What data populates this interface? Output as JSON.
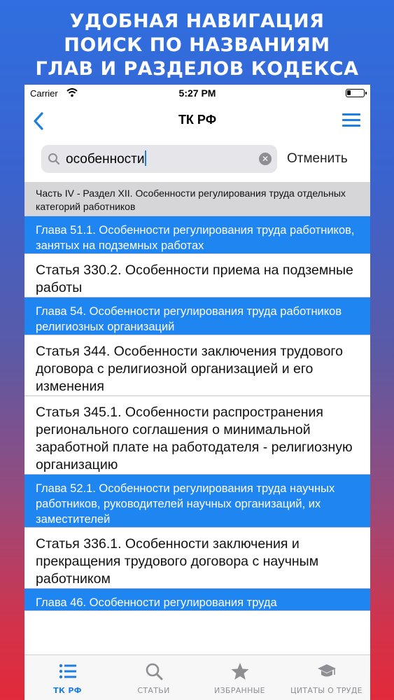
{
  "promo": {
    "line1": "УДОБНАЯ НАВИГАЦИЯ",
    "line2": "ПОИСК ПО НАЗВАНИЯМ",
    "line3": "ГЛАВ И РАЗДЕЛОВ КОДЕКСА"
  },
  "status": {
    "carrier": "Carrier",
    "time": "5:27 PM"
  },
  "nav": {
    "title": "ТК РФ"
  },
  "search": {
    "value": "особенности",
    "cancel_label": "Отменить"
  },
  "results": [
    {
      "type": "part",
      "text": "Часть IV - Раздел XII. Особенности регулирования труда отдельных категорий работников"
    },
    {
      "type": "chapter",
      "text": "Глава 51.1. Особенности регулирования труда работников, занятых на подземных работах"
    },
    {
      "type": "article",
      "text": "Статья 330.2. Особенности приема на подземные работы"
    },
    {
      "type": "chapter",
      "text": "Глава 54. Особенности регулирования труда работников религиозных организаций"
    },
    {
      "type": "article",
      "text": "Статья 344. Особенности заключения трудового договора с религиозной организацией и его изменения"
    },
    {
      "type": "article",
      "text": "Статья 345.1. Особенности распространения регионального соглашения о минимальной заработной плате на работодателя - религиозную организацию"
    },
    {
      "type": "chapter",
      "text": "Глава 52.1. Особенности регулирования труда научных работников, руководителей научных организаций, их заместителей"
    },
    {
      "type": "article",
      "text": "Статья 336.1. Особенности заключения и прекращения трудового договора с научным работником"
    },
    {
      "type": "chapter",
      "text": "Глава 46. Особенности регулирования труда"
    }
  ],
  "tabs": [
    {
      "label": "ТК РФ",
      "icon": "list-icon",
      "active": true
    },
    {
      "label": "СТАТЬИ",
      "icon": "search-icon",
      "active": false
    },
    {
      "label": "ИЗБРАННЫЕ",
      "icon": "star-icon",
      "active": false
    },
    {
      "label": "ЦИТАТЫ О ТРУДЕ",
      "icon": "graduation-cap-icon",
      "active": false
    }
  ],
  "colors": {
    "accent": "#1f7fe0",
    "chapter_bg": "#1f85f0",
    "part_bg": "#d6d6d8"
  }
}
